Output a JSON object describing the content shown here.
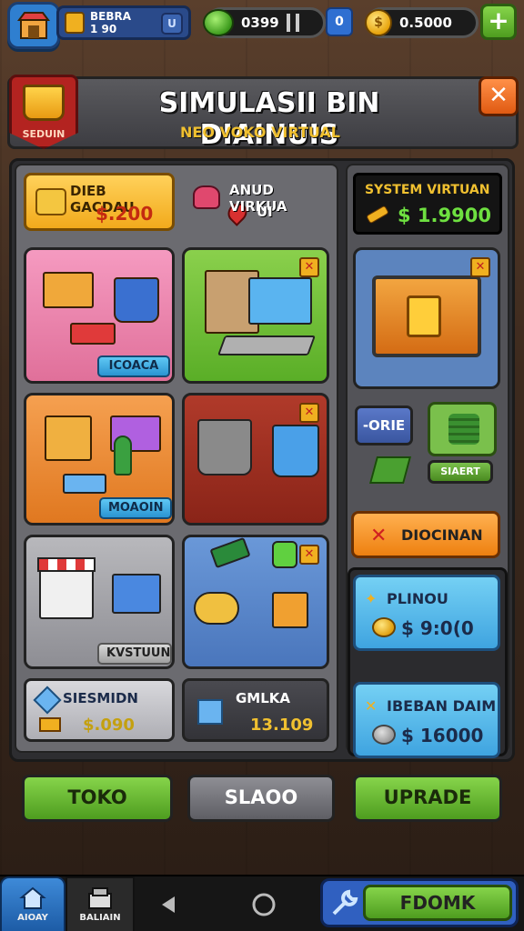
{
  "topbar": {
    "player_name": "BEBRA",
    "player_level": "1 90",
    "player_btn": "U",
    "gems": "0399",
    "gem_add": "0",
    "coins": "0.5000",
    "plus": "+"
  },
  "header": {
    "badge": "SEDUIN",
    "title": "SIMULASII BIN DIAINUIS",
    "subtitle": "NEO VOKO VIRTUAL",
    "close": "✕"
  },
  "stats": {
    "card1_label": "DIEB GACDAU",
    "card1_value": "$.200",
    "card2_label": "ANUD VIRKUA",
    "card2_value": "UI",
    "system_label": "SYSTEM VIRTUAN",
    "system_value": "$ 1.9900"
  },
  "tiles": {
    "tile1_tag": "ICOACA",
    "tile3_tag": "MOAOIN",
    "tile5_tag": "KVSTUUN",
    "corner": "✕"
  },
  "right": {
    "ore_label": "-ORIE",
    "sigaert_label": "SIAERT",
    "diocinan": "DIOCINAN",
    "card_a_label": "PLINOU",
    "card_a_value": "$ 9:0(0",
    "card_b_label": "IBEBAN DAIM",
    "card_b_value": "$ 16000"
  },
  "bottom_stats": {
    "left_label": "SIESMIDN",
    "left_value": "$.090",
    "right_label": "GMLKA",
    "right_value": "13.109"
  },
  "actions": {
    "toko": "TOKO",
    "sdaoo": "SLAOO",
    "upgrade": "UPRADE"
  },
  "nav": {
    "home": "AIOAY",
    "shop": "BALIAIN",
    "fdomk": "FDOMK"
  },
  "colors": {
    "accent_green": "#5aae27",
    "accent_orange": "#ee8010",
    "accent_blue": "#3fa4e0",
    "money_green": "#6ee040",
    "title_gold": "#f0c030"
  }
}
